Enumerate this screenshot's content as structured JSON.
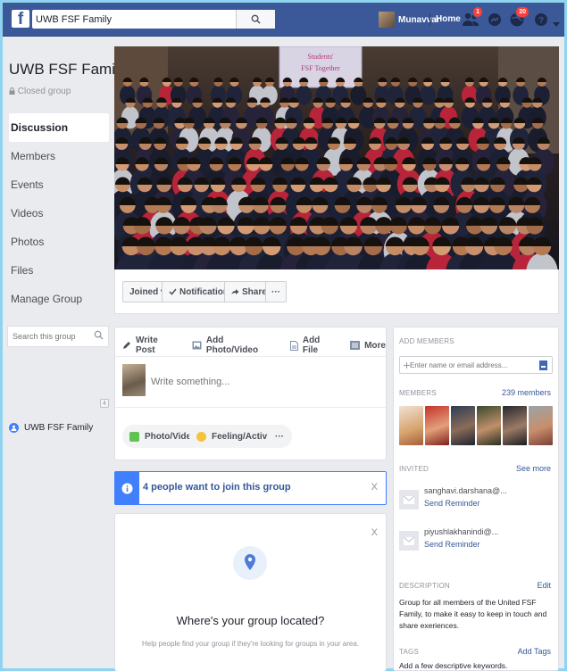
{
  "topbar": {
    "search_value": "UWB FSF Family",
    "user_name": "Munavvar",
    "home_label": "Home",
    "friend_requests_badge": "1",
    "notifications_badge": "20"
  },
  "sidebar": {
    "group_name": "UWB FSF Family",
    "privacy": "Closed group",
    "nav": [
      "Discussion",
      "Members",
      "Events",
      "Videos",
      "Photos",
      "Files",
      "Manage Group"
    ],
    "search_placeholder": "Search this group",
    "count": "4",
    "group_shortcut": "UWB FSF Family"
  },
  "cover": {
    "banner_line1": "Students'",
    "banner_line2": "FSF Together"
  },
  "cover_actions": {
    "joined": "Joined ▾",
    "notifications": "Notifications",
    "share": "Share",
    "more": "···"
  },
  "composer": {
    "tabs": [
      "Write Post",
      "Add Photo/Video",
      "Add File",
      "More"
    ],
    "placeholder": "Write something...",
    "photo_video": "Photo/Video",
    "feeling": "Feeling/Activity",
    "more": "···"
  },
  "join_banner": {
    "text": "4 people want to join this group",
    "close": "X"
  },
  "location_card": {
    "title": "Where's your group located?",
    "subtitle": "Help people find your group if they're looking for groups in your area.",
    "close": "X"
  },
  "right": {
    "add_members_heading": "ADD MEMBERS",
    "add_members_placeholder": "Enter name or email address...",
    "members_heading": "MEMBERS",
    "members_count": "239 members",
    "invited_heading": "INVITED",
    "see_more": "See more",
    "invited": [
      {
        "name": "sanghavi.darshana@...",
        "action": "Send Reminder"
      },
      {
        "name": "piyushlakhanindi@...",
        "action": "Send Reminder"
      }
    ],
    "description_heading": "DESCRIPTION",
    "edit": "Edit",
    "description": "Group for all members of the United FSF Family, to make it easy to keep in touch and share exeriences.",
    "tags_heading": "TAGS",
    "add_tags": "Add Tags",
    "tags_hint": "Add a few descriptive keywords."
  },
  "colors": {
    "brand": "#3b5998",
    "link": "#365899",
    "accent": "#4080ff",
    "page_bg": "#e9ebee",
    "frame": "#8fd3f1"
  }
}
